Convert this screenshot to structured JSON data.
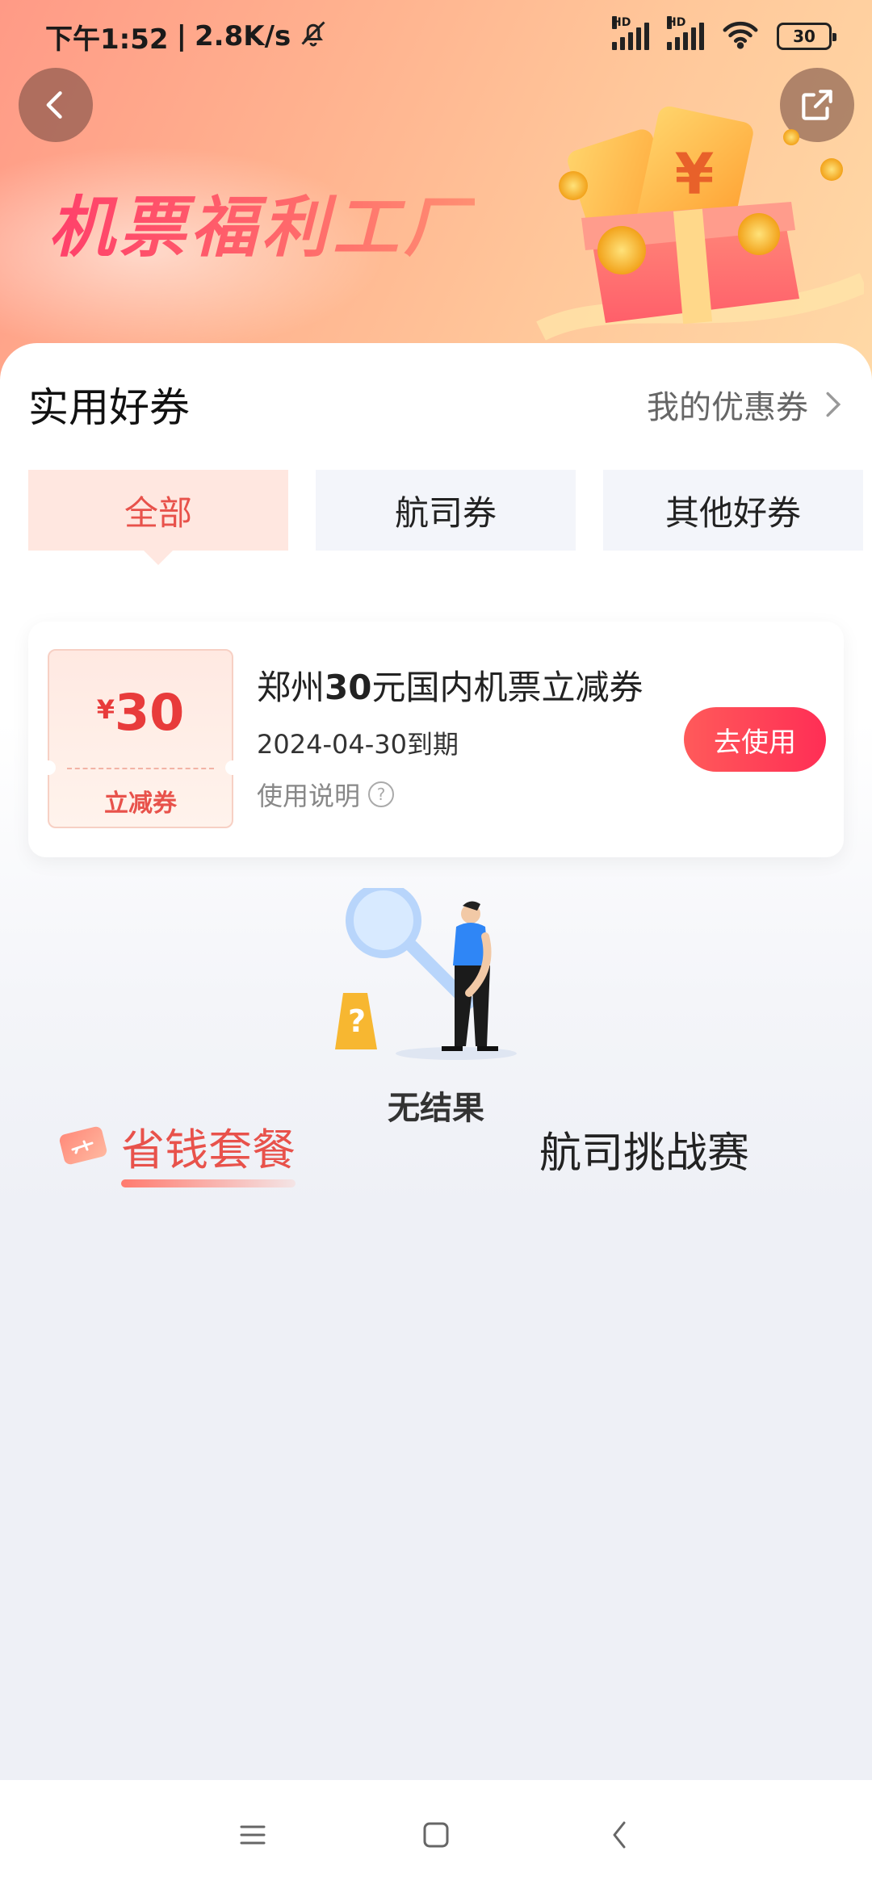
{
  "status_bar": {
    "time": "下午1:52",
    "network_speed": "2.8K/s",
    "battery": "30",
    "signal_label": "HD"
  },
  "header": {
    "title": "机票福利工厂"
  },
  "coupons_section": {
    "title": "实用好券",
    "my_coupons_link": "我的优惠券",
    "tabs": [
      "全部",
      "航司券",
      "其他好券"
    ],
    "active_tab": "全部"
  },
  "coupon": {
    "currency": "¥",
    "amount": "30",
    "type": "立减券",
    "title_prefix": "郑州",
    "title_amount": "30",
    "title_suffix": "元国内机票立减券",
    "expiry": "2024-04-30到期",
    "rules_label": "使用说明",
    "use_button": "去使用"
  },
  "packages_section": {
    "tabs": [
      "省钱套餐",
      "航司挑战赛"
    ],
    "active_tab": "省钱套餐",
    "empty_text": "无结果"
  },
  "colors": {
    "accent": "#e8524b",
    "button_gradient_start": "#ff5a5a",
    "button_gradient_end": "#ff2e55"
  }
}
